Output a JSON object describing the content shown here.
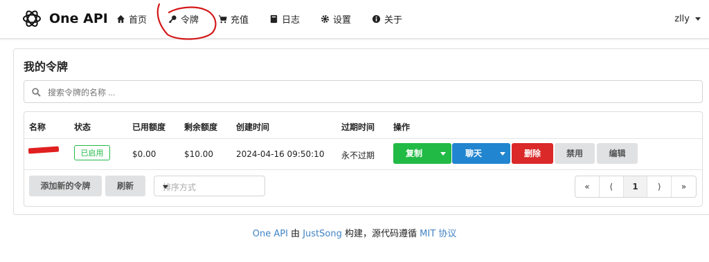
{
  "nav": {
    "brand": "One API",
    "items": [
      "首页",
      "令牌",
      "充值",
      "日志",
      "设置",
      "关于"
    ],
    "user": "zlly"
  },
  "page": {
    "title": "我的令牌",
    "search_placeholder": "搜索令牌的名称 ..."
  },
  "table": {
    "headers": [
      "名称",
      "状态",
      "已用额度",
      "剩余额度",
      "创建时间",
      "过期时间",
      "操作"
    ],
    "row": {
      "status": "已启用",
      "used": "$0.00",
      "remaining": "$10.00",
      "created": "2024-04-16 09:50:10",
      "expires": "永不过期"
    },
    "actions": {
      "copy": "复制",
      "chat": "聊天",
      "delete": "删除",
      "disable": "禁用",
      "edit": "编辑"
    },
    "bottom": {
      "add": "添加新的令牌",
      "refresh": "刷新",
      "sort_placeholder": "排序方式"
    },
    "pagination": [
      "«",
      "⟨",
      "1",
      "⟩",
      "»"
    ]
  },
  "footer": {
    "project": "One API",
    "by": "由",
    "author": "JustSong",
    "middle": "构建，源代码遵循",
    "license": "MIT 协议"
  },
  "colors": {
    "green": "#21ba45",
    "blue": "#2185d0",
    "red": "#db2828",
    "annotation": "#d41818"
  }
}
